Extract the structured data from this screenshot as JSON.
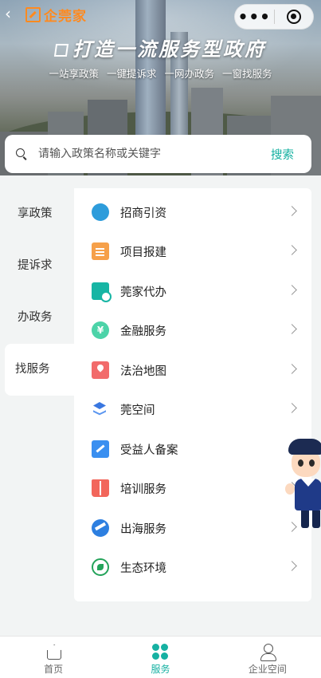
{
  "header": {
    "back_glyph": "‹",
    "brand": "企莞家",
    "slogan": "打造一流服务型政府",
    "taglines": [
      "一站享政策",
      "一键提诉求",
      "一网办政务",
      "一窗找服务"
    ],
    "capsule_more": "•••"
  },
  "search": {
    "placeholder": "请输入政策名称或关键字",
    "button": "搜索"
  },
  "left_nav": {
    "items": [
      {
        "label": "享政策",
        "active": false
      },
      {
        "label": "提诉求",
        "active": false
      },
      {
        "label": "办政务",
        "active": false
      },
      {
        "label": "找服务",
        "active": true
      }
    ]
  },
  "services": {
    "items": [
      {
        "label": "招商引资",
        "icon": "investment-icon"
      },
      {
        "label": "项目报建",
        "icon": "project-doc-icon"
      },
      {
        "label": "莞家代办",
        "icon": "clipboard-clock-icon"
      },
      {
        "label": "金融服务",
        "icon": "yen-coin-icon"
      },
      {
        "label": "法治地图",
        "icon": "map-pin-icon"
      },
      {
        "label": "莞空间",
        "icon": "layers-icon"
      },
      {
        "label": "受益人备案",
        "icon": "edit-form-icon"
      },
      {
        "label": "培训服务",
        "icon": "book-icon"
      },
      {
        "label": "出海服务",
        "icon": "globe-plane-icon"
      },
      {
        "label": "生态环境",
        "icon": "eco-badge-icon"
      }
    ]
  },
  "tabbar": {
    "tabs": [
      {
        "label": "首页",
        "active": false
      },
      {
        "label": "服务",
        "active": true
      },
      {
        "label": "企业空间",
        "active": false
      }
    ]
  },
  "colors": {
    "accent": "#16b1a2",
    "brand_orange": "#ff8a1f"
  }
}
